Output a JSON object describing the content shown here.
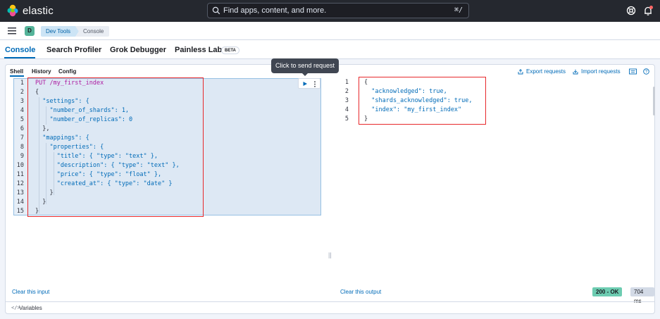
{
  "app": {
    "logo_text": "elastic"
  },
  "search": {
    "placeholder": "Find apps, content, and more.",
    "shortcut": "⌘/"
  },
  "space": {
    "initial": "D"
  },
  "breadcrumbs": [
    {
      "label": "Dev Tools"
    },
    {
      "label": "Console"
    }
  ],
  "tabs": [
    {
      "label": "Console",
      "active": true
    },
    {
      "label": "Search Profiler"
    },
    {
      "label": "Grok Debugger"
    },
    {
      "label": "Painless Lab",
      "badge": "BETA"
    }
  ],
  "subtabs": [
    {
      "label": "Shell",
      "active": true
    },
    {
      "label": "History"
    },
    {
      "label": "Config"
    }
  ],
  "toolbar": {
    "export_label": "Export requests",
    "import_label": "Import requests"
  },
  "tooltip": "Click to send request",
  "editor": {
    "line_numbers": [
      "1",
      "2",
      "3",
      "4",
      "5",
      "6",
      "7",
      "8",
      "9",
      "10",
      "11",
      "12",
      "13",
      "14",
      "15"
    ],
    "lines": [
      "PUT /my_first_index",
      "{",
      "  \"settings\": {",
      "    \"number_of_shards\": 1,",
      "    \"number_of_replicas\": 0",
      "  },",
      "  \"mappings\": {",
      "    \"properties\": {",
      "      \"title\": { \"type\": \"text\" },",
      "      \"description\": { \"type\": \"text\" },",
      "      \"price\": { \"type\": \"float\" },",
      "      \"created_at\": { \"type\": \"date\" }",
      "    }",
      "  }",
      "}"
    ]
  },
  "output": {
    "line_numbers": [
      "1",
      "2",
      "3",
      "4",
      "5"
    ],
    "lines": [
      "{",
      "  \"acknowledged\": true,",
      "  \"shards_acknowledged\": true,",
      "  \"index\": \"my_first_index\"",
      "}"
    ]
  },
  "clear_input_label": "Clear this input",
  "clear_output_label": "Clear this output",
  "status": {
    "code": "200 - OK",
    "time": "704 ms"
  },
  "variables_label": "Variables",
  "colors": {
    "accent": "#006bb8",
    "highlight": "#e7282b",
    "ok": "#6dccb1"
  }
}
